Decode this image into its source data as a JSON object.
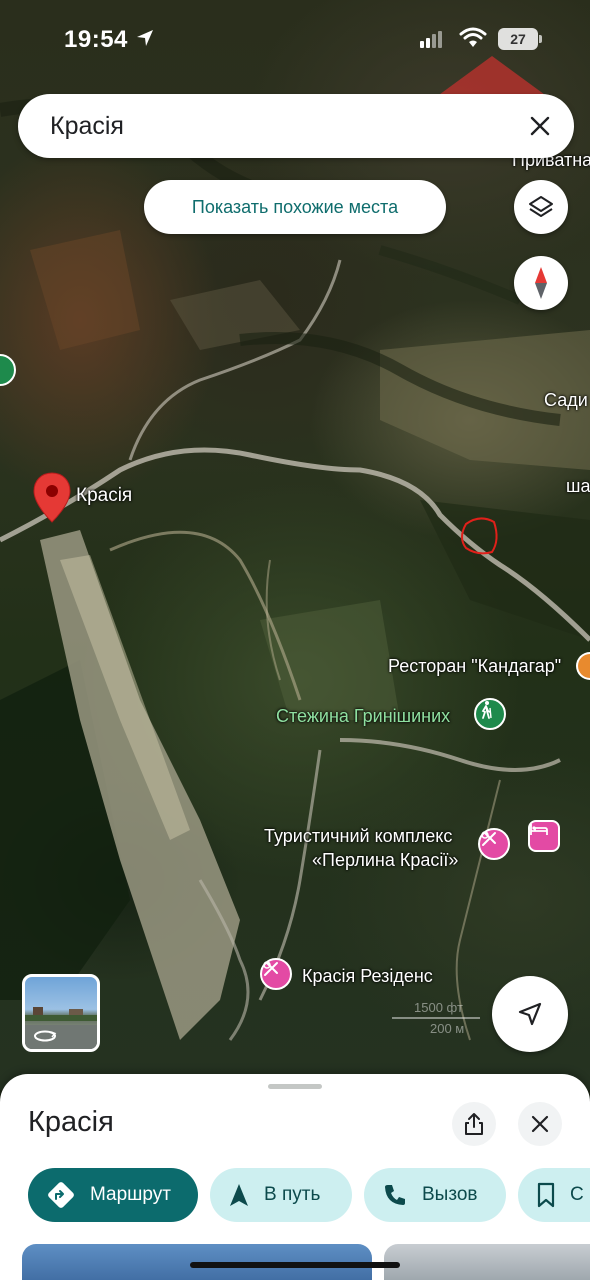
{
  "status_bar": {
    "time": "19:54",
    "battery": "27"
  },
  "search": {
    "query": "Красія"
  },
  "map": {
    "similar_places_label": "Показать похожие места",
    "labels": {
      "main_place": "Красія",
      "restaurant": "Ресторан \"Кандагар\"",
      "trail": "Стежина Гринішиних",
      "complex_line1": "Туристичний комплекс",
      "complex_line2": "«Перлина Красії»",
      "residence": "Красія Резіденс",
      "edge_top": "Приватна",
      "edge_sady": "Сади",
      "edge_sha": "ша"
    },
    "scale": {
      "feet": "1500 фт",
      "meters": "200 м"
    }
  },
  "sheet": {
    "title": "Красія",
    "actions": {
      "route": "Маршрут",
      "go": "В путь",
      "call": "Вызов",
      "save_partial": "С"
    }
  },
  "colors": {
    "accent": "#0c6b6d",
    "chip_bg": "#cdeff0",
    "pin_red": "#e53935",
    "pin_pink": "#e34aa4"
  }
}
